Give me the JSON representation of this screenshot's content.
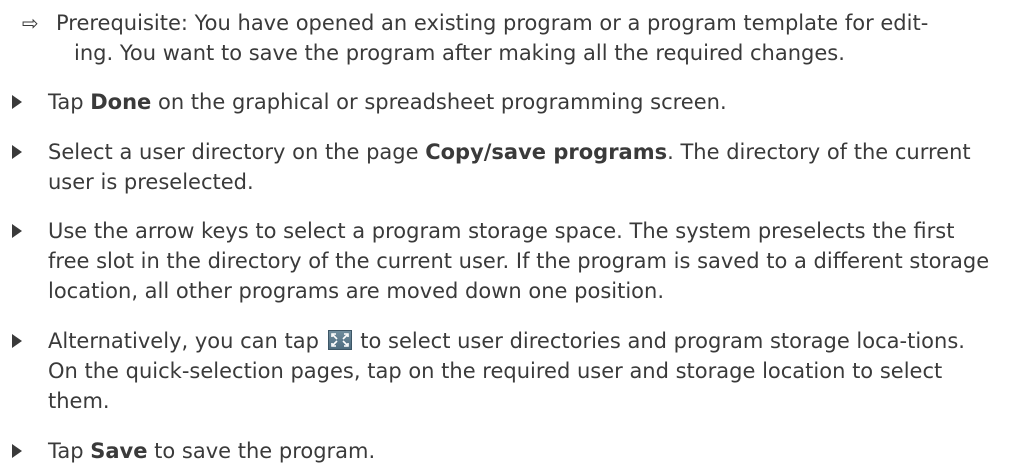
{
  "prerequisite": {
    "line1": "Prerequisite: You have opened an existing program or a program template for edit-",
    "line2": "ing. You want to save the program after making all the required changes."
  },
  "steps": [
    {
      "pre": "Tap ",
      "bold": "Done",
      "post": " on the graphical or spreadsheet programming screen."
    },
    {
      "pre": "Select a user directory on the page ",
      "bold": "Copy/save programs",
      "post": ". The directory of the current user is preselected."
    },
    {
      "text": "Use the arrow keys to select a program storage space. The system preselects the first free slot in the directory of the current user. If the program is saved to a different storage location, all other programs are moved down one position."
    },
    {
      "pre": "Alternatively, you can tap ",
      "post": " to select user directories and program storage loca-tions. On the quick-selection pages, tap on the required user and storage location to select them."
    },
    {
      "pre": "Tap ",
      "bold": "Save",
      "post": " to save the program."
    }
  ],
  "icons": {
    "prerequisite_marker": "arrow-right-icon",
    "bullet": "triangle-bullet-icon",
    "inline": "fullscreen-expand-icon"
  }
}
